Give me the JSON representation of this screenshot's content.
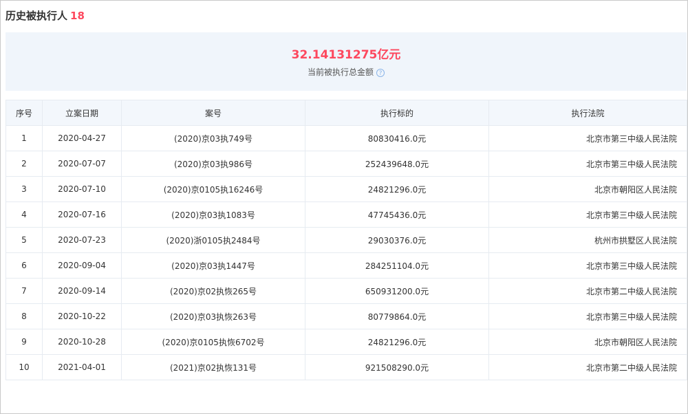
{
  "header": {
    "title": "历史被执行人",
    "count": "18"
  },
  "summary": {
    "amount": "32.14131275亿元",
    "label": "当前被执行总金额",
    "help_glyph": "?"
  },
  "table": {
    "columns": [
      "序号",
      "立案日期",
      "案号",
      "执行标的",
      "执行法院"
    ],
    "rows": [
      [
        "1",
        "2020-04-27",
        "(2020)京03执749号",
        "80830416.0元",
        "北京市第三中级人民法院"
      ],
      [
        "2",
        "2020-07-07",
        "(2020)京03执986号",
        "252439648.0元",
        "北京市第三中级人民法院"
      ],
      [
        "3",
        "2020-07-10",
        "(2020)京0105执16246号",
        "24821296.0元",
        "北京市朝阳区人民法院"
      ],
      [
        "4",
        "2020-07-16",
        "(2020)京03执1083号",
        "47745436.0元",
        "北京市第三中级人民法院"
      ],
      [
        "5",
        "2020-07-23",
        "(2020)浙0105执2484号",
        "29030376.0元",
        "杭州市拱墅区人民法院"
      ],
      [
        "6",
        "2020-09-04",
        "(2020)京03执1447号",
        "284251104.0元",
        "北京市第三中级人民法院"
      ],
      [
        "7",
        "2020-09-14",
        "(2020)京02执恢265号",
        "650931200.0元",
        "北京市第二中级人民法院"
      ],
      [
        "8",
        "2020-10-22",
        "(2020)京03执恢263号",
        "80779864.0元",
        "北京市第三中级人民法院"
      ],
      [
        "9",
        "2020-10-28",
        "(2020)京0105执恢6702号",
        "24821296.0元",
        "北京市朝阳区人民法院"
      ],
      [
        "10",
        "2021-04-01",
        "(2021)京02执恢131号",
        "921508290.0元",
        "北京市第二中级人民法院"
      ]
    ]
  }
}
